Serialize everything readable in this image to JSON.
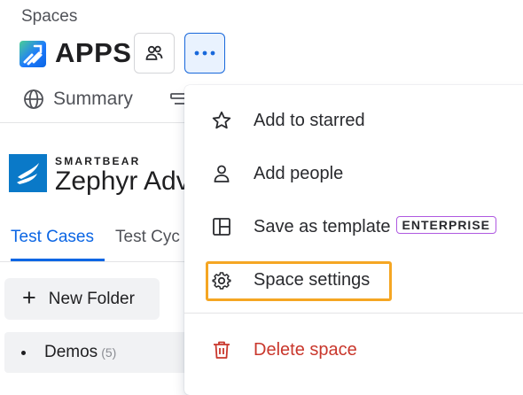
{
  "header": {
    "breadcrumb": "Spaces",
    "space_title": "APPS",
    "people_icon": "people-icon",
    "more_icon": "more-icon"
  },
  "tabs": {
    "summary_label": "Summary",
    "summary_icon": "globe-icon"
  },
  "app": {
    "brand": "SMARTBEAR",
    "product": "Zephyr Adv",
    "tab_test_cases": "Test Cases",
    "tab_test_cycles": "Test Cyc",
    "new_folder_label": "New Folder",
    "folder_name": "Demos",
    "folder_count": "(5)"
  },
  "menu": {
    "add_to_starred": "Add to starred",
    "add_people": "Add people",
    "save_as_template": "Save as template",
    "enterprise_badge": "ENTERPRISE",
    "space_settings": "Space settings",
    "delete_space": "Delete space"
  },
  "colors": {
    "accent": "#0c66e4",
    "danger": "#c9372c",
    "highlight": "#f5a623",
    "badge_border": "#af59e1"
  }
}
